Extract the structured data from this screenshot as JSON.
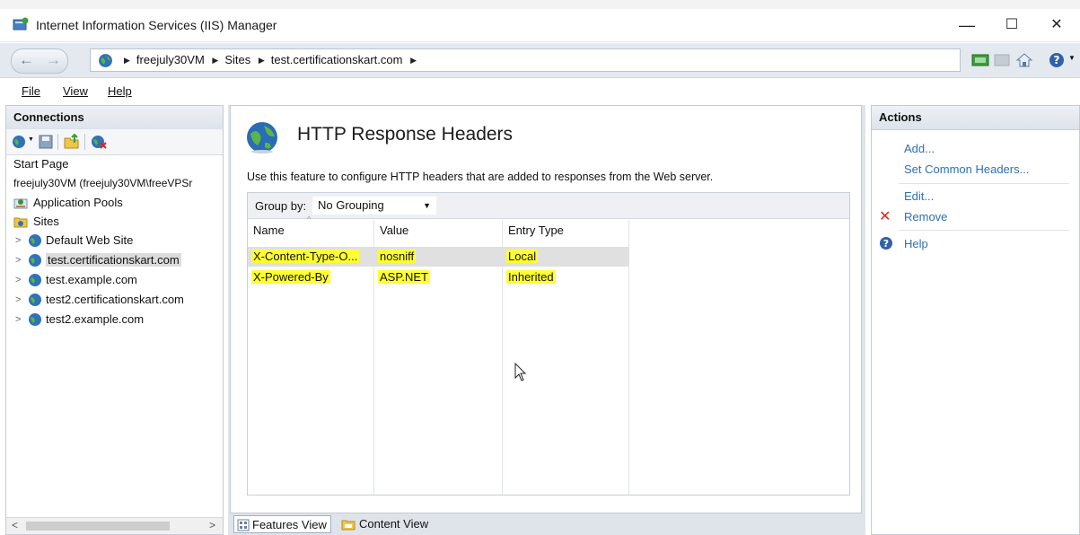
{
  "window": {
    "title": "Internet Information Services (IIS) Manager",
    "minimize": "—",
    "maximize": "☐",
    "close": "✕"
  },
  "address": {
    "crumbs": [
      "freejuly30VM",
      "Sites",
      "test.certificationskart.com"
    ]
  },
  "menu": {
    "file": "File",
    "view": "View",
    "help": "Help"
  },
  "connections": {
    "header": "Connections",
    "tree": {
      "start_page": "Start Page",
      "server": "freejuly30VM (freejuly30VM\\freeVPSr",
      "app_pools": "Application Pools",
      "sites": "Sites",
      "site_items": [
        "Default Web Site",
        "test.certificationskart.com",
        "test.example.com",
        "test2.certificationskart.com",
        "test2.example.com"
      ]
    }
  },
  "feature": {
    "title": "HTTP Response Headers",
    "description": "Use this feature to configure HTTP headers that are added to responses from the Web server.",
    "group_by_label": "Group by:",
    "group_by_value": "No Grouping",
    "columns": [
      "Name",
      "Value",
      "Entry Type"
    ],
    "rows": [
      {
        "name": "X-Content-Type-O...",
        "value": "nosniff",
        "entry_type": "Local"
      },
      {
        "name": "X-Powered-By",
        "value": "ASP.NET",
        "entry_type": "Inherited"
      }
    ]
  },
  "view_tabs": {
    "features": "Features View",
    "content": "Content View"
  },
  "actions": {
    "header": "Actions",
    "add": "Add...",
    "set_common": "Set Common Headers...",
    "edit": "Edit...",
    "remove": "Remove",
    "help": "Help"
  },
  "colors": {
    "highlight": "#ffff33",
    "link": "#2f6fb6",
    "remove_x": "#d9261c"
  }
}
